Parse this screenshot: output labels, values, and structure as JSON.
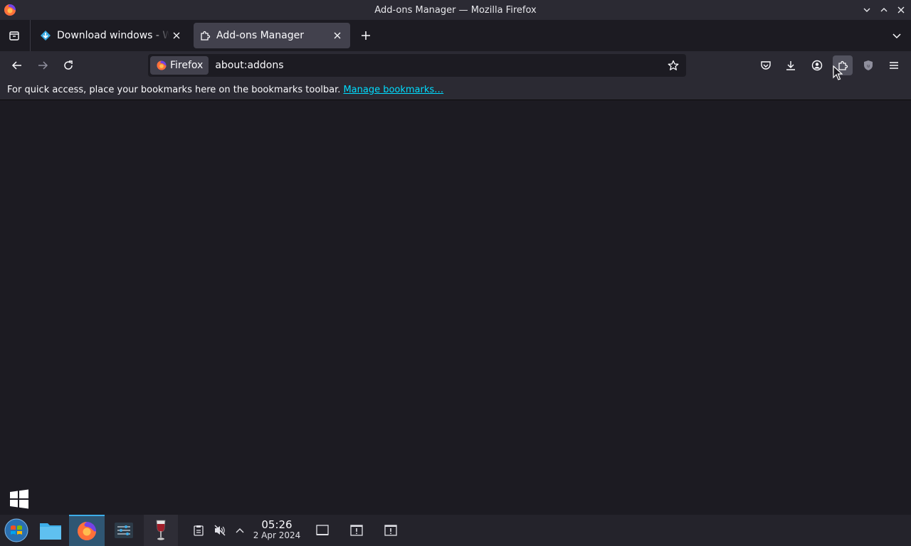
{
  "window": {
    "title": "Add-ons Manager — Mozilla Firefox"
  },
  "tabs": [
    {
      "label": "Download windows - Win",
      "icon": "download-site-icon",
      "active": false
    },
    {
      "label": "Add-ons Manager",
      "icon": "puzzle-icon",
      "active": true
    }
  ],
  "urlbar": {
    "identity_label": "Firefox",
    "url": "about:addons"
  },
  "bookmarks_bar": {
    "message": "For quick access, place your bookmarks here on the bookmarks toolbar.",
    "link_label": "Manage bookmarks…"
  },
  "taskbar": {
    "time": "05:26",
    "date": "2 Apr 2024",
    "items": [
      "start-menu-icon",
      "file-manager-icon",
      "firefox-icon",
      "system-settings-icon",
      "wine-icon"
    ]
  },
  "colors": {
    "accent": "#00ddff",
    "taskbar_active": "#2f5673"
  }
}
